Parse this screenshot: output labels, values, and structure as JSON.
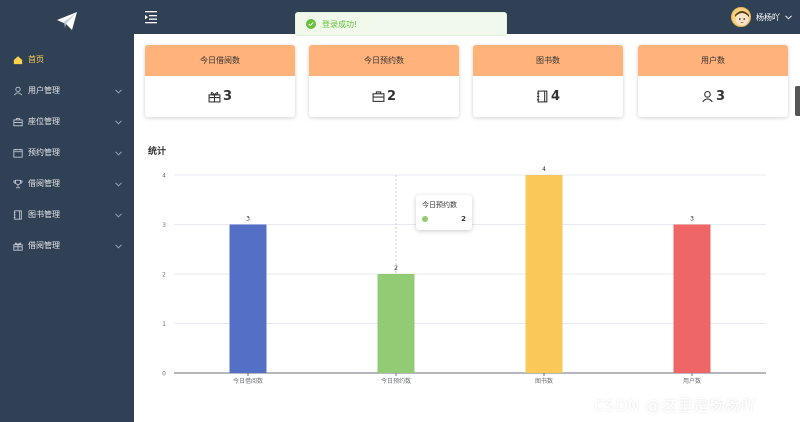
{
  "sidebar": {
    "items": [
      {
        "label": "首页",
        "icon": "home-icon",
        "active": true,
        "has_submenu": false
      },
      {
        "label": "用户管理",
        "icon": "user-icon",
        "active": false,
        "has_submenu": true
      },
      {
        "label": "座位管理",
        "icon": "briefcase-icon",
        "active": false,
        "has_submenu": true
      },
      {
        "label": "预约管理",
        "icon": "calendar-icon",
        "active": false,
        "has_submenu": true
      },
      {
        "label": "借阅管理",
        "icon": "trophy-icon",
        "active": false,
        "has_submenu": true
      },
      {
        "label": "图书管理",
        "icon": "notebook-icon",
        "active": false,
        "has_submenu": true
      },
      {
        "label": "借阅管理",
        "icon": "gift-icon",
        "active": false,
        "has_submenu": true
      }
    ]
  },
  "header": {
    "username": "杨杨吖"
  },
  "toast": {
    "message": "登录成功!",
    "color": "#67c23a"
  },
  "cards": [
    {
      "title": "今日借阅数",
      "value": "3",
      "icon": "gift-icon"
    },
    {
      "title": "今日预约数",
      "value": "2",
      "icon": "briefcase-icon"
    },
    {
      "title": "图书数",
      "value": "4",
      "icon": "notebook-icon"
    },
    {
      "title": "用户数",
      "value": "3",
      "icon": "user-icon"
    }
  ],
  "stats": {
    "title": "统计"
  },
  "chart_data": {
    "type": "bar",
    "categories": [
      "今日借阅数",
      "今日预约数",
      "图书数",
      "用户数"
    ],
    "values": [
      3,
      2,
      4,
      3
    ],
    "colors": [
      "#5470c6",
      "#91cc75",
      "#fac858",
      "#ee6666"
    ],
    "ylim": [
      0,
      4
    ],
    "yticks": [
      "0",
      "1",
      "2",
      "3",
      "4"
    ],
    "grid": true
  },
  "tooltip": {
    "title": "今日预约数",
    "value": "2",
    "color": "#91cc75"
  },
  "watermark": "CSDN @这里是杨杨吖",
  "colors": {
    "sidebar_bg": "#304156",
    "active_text": "#ffd04b",
    "card_header": "#ffb27a"
  }
}
